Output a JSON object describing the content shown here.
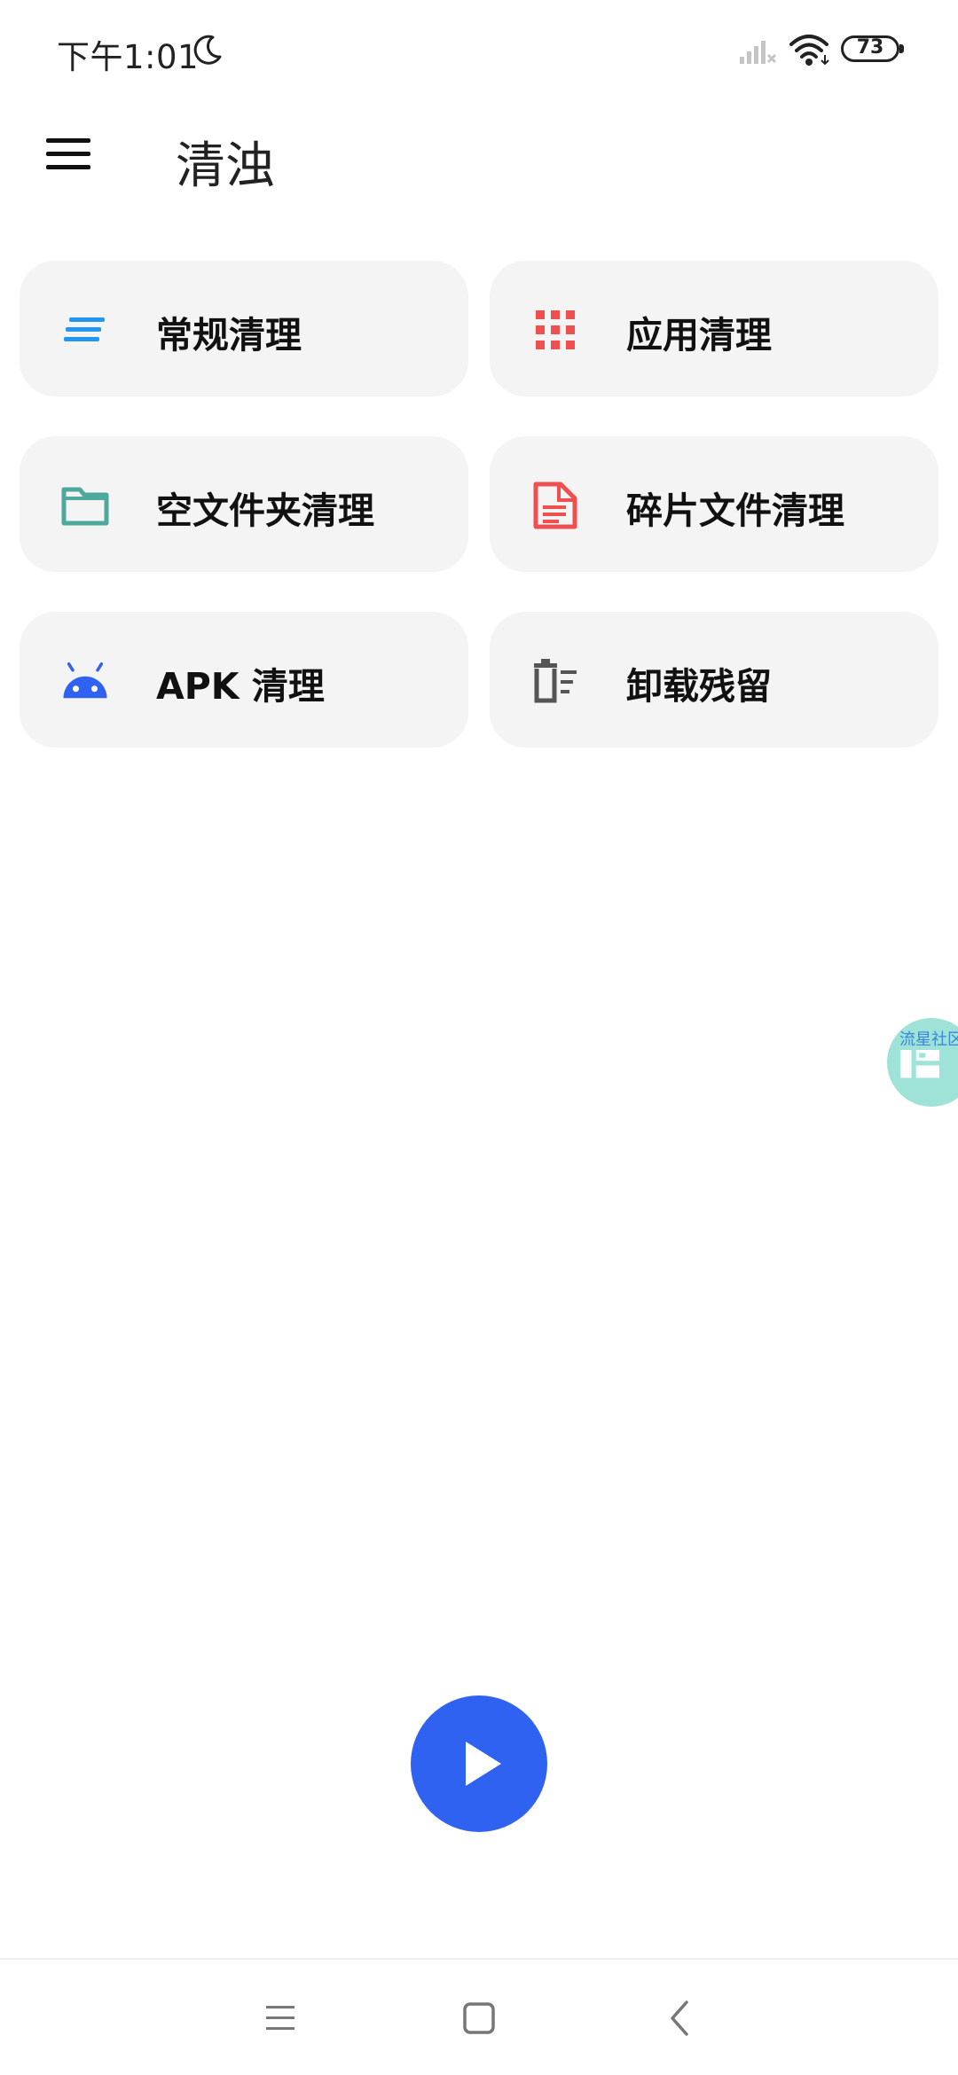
{
  "status_bar": {
    "time": "下午1:01",
    "battery": "73",
    "icons": [
      "moon-icon",
      "signal-icon",
      "wifi-icon",
      "battery-icon"
    ]
  },
  "app_bar": {
    "title": "清浊",
    "menu_icon": "menu-icon"
  },
  "cards": [
    {
      "label": "常规清理",
      "icon": "lines-icon",
      "color": "#2196f3"
    },
    {
      "label": "应用清理",
      "icon": "grid-icon",
      "color": "#ef4f4f"
    },
    {
      "label": "空文件夹清理",
      "icon": "folder-icon",
      "color": "#4fa89c"
    },
    {
      "label": "碎片文件清理",
      "icon": "document-icon",
      "color": "#ef4f4f"
    },
    {
      "label": "APK 清理",
      "icon": "android-icon",
      "color": "#2f62f0"
    },
    {
      "label": "卸载残留",
      "icon": "trash-list-icon",
      "color": "#555555"
    }
  ],
  "floating_bubble": {
    "label": "流星社区"
  },
  "fab": {
    "icon": "play-icon",
    "color": "#2f62f0"
  },
  "nav_bar": {
    "icons": [
      "recents-icon",
      "home-icon",
      "back-icon"
    ]
  }
}
